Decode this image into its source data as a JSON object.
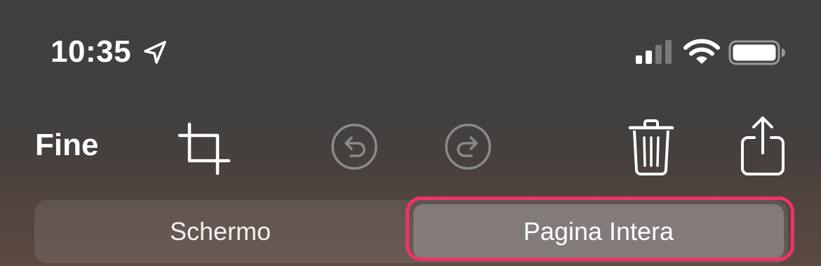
{
  "status_bar": {
    "time": "10:35",
    "icons": [
      "location-arrow-icon",
      "cellular-signal-icon",
      "wifi-icon",
      "battery-icon"
    ]
  },
  "toolbar": {
    "done_label": "Fine",
    "tools": [
      "crop-icon",
      "undo-icon",
      "redo-icon",
      "trash-icon",
      "share-icon"
    ]
  },
  "segmented_control": {
    "options": [
      {
        "label": "Schermo",
        "selected": false
      },
      {
        "label": "Pagina Intera",
        "selected": true
      }
    ]
  },
  "colors": {
    "highlight_ring": "#ee3468",
    "selected_segment": "#837b79",
    "disabled_icon": "#8a8a8a",
    "foreground": "#ffffff"
  }
}
